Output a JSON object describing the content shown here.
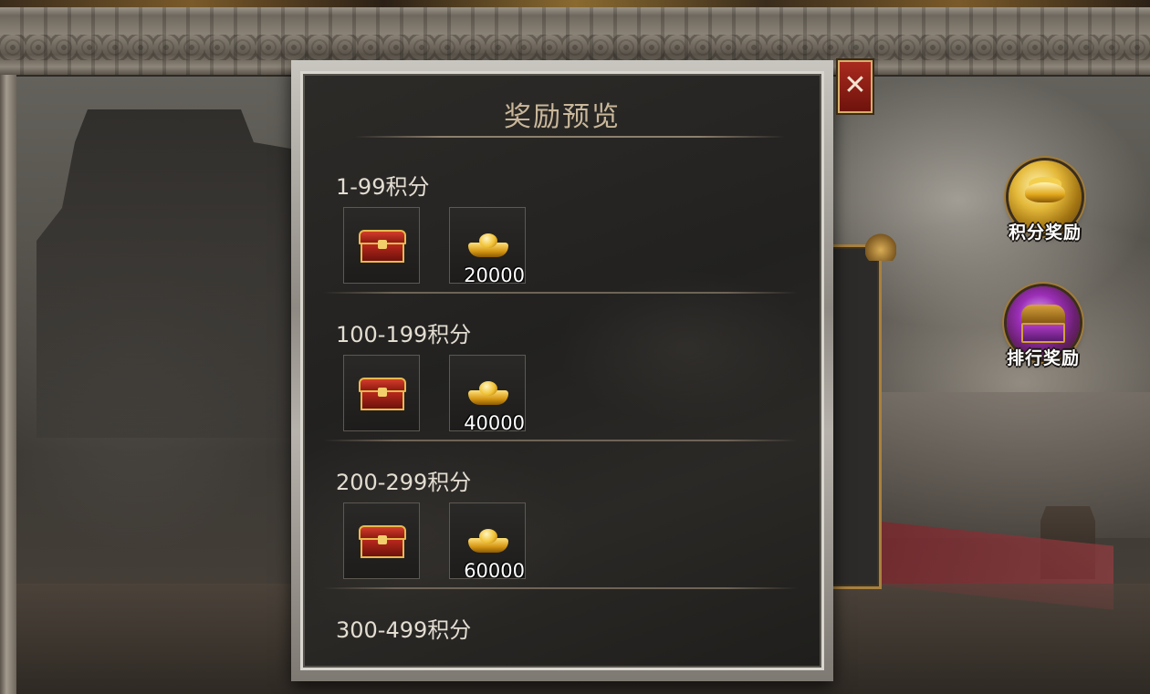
{
  "dialog": {
    "title": "奖励预览",
    "close_symbol": "✕"
  },
  "tiers": [
    {
      "label": "1-99积分",
      "chest_icon": "red-chest-icon",
      "ingot_icon": "gold-ingot-icon",
      "ingot_count": "20000"
    },
    {
      "label": "100-199积分",
      "chest_icon": "red-chest-icon",
      "ingot_icon": "gold-ingot-icon",
      "ingot_count": "40000"
    },
    {
      "label": "200-299积分",
      "chest_icon": "red-chest-icon",
      "ingot_icon": "gold-ingot-icon",
      "ingot_count": "60000"
    },
    {
      "label": "300-499积分"
    }
  ],
  "side_buttons": {
    "points_reward": {
      "label": "积分奖励",
      "icon": "gold-ingots-icon"
    },
    "rank_reward": {
      "label": "排行奖励",
      "icon": "treasure-chest-icon"
    }
  },
  "colors": {
    "title_text": "#c9b79a",
    "tier_text": "#e3ddd2",
    "close_button": "#a92a1e",
    "frame_gold": "#a9813e"
  }
}
